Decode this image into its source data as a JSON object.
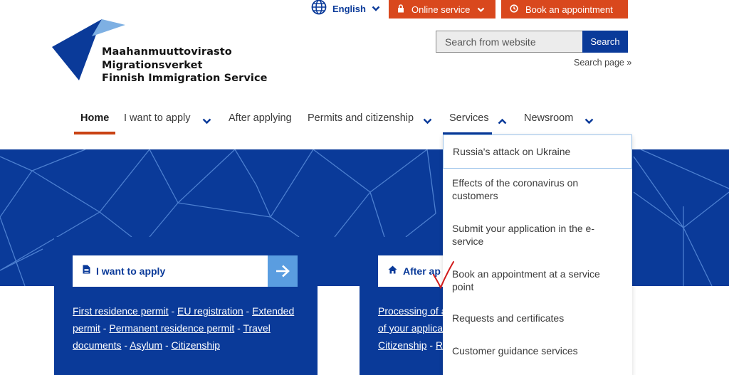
{
  "header": {
    "language": {
      "label": "English",
      "icon": "globe-icon"
    },
    "online_service": {
      "label": "Online service",
      "icon": "lock-icon"
    },
    "book_appointment": {
      "label": "Book an appointment",
      "icon": "clock-icon"
    }
  },
  "logo": {
    "line1": "Maahanmuuttovirasto",
    "line2": "Migrationsverket",
    "line3": "Finnish Immigration Service"
  },
  "search": {
    "placeholder": "Search from website",
    "button_label": "Search",
    "page_link": "Search page »"
  },
  "nav": {
    "items": [
      {
        "label": "Home",
        "active": true
      },
      {
        "label": "I want to apply",
        "has_dropdown": true
      },
      {
        "label": "After applying"
      },
      {
        "label": "Permits and citizenship",
        "has_dropdown": true
      },
      {
        "label": "Services",
        "has_dropdown": true,
        "expanded": true
      },
      {
        "label": "Newsroom",
        "has_dropdown": true
      }
    ]
  },
  "dropdown": {
    "items": [
      "Russia's attack on Ukraine",
      "Effects of the coronavirus on customers",
      "Submit your application in the e-service",
      "Book an appointment at a service point",
      "Requests and certificates",
      "Customer guidance services"
    ]
  },
  "cards": {
    "apply": {
      "title": "I want to apply",
      "icon": "document-icon",
      "links": [
        "First residence permit",
        "EU registration",
        "Extended permit",
        "Permanent residence permit",
        "Travel documents",
        "Asylum",
        "Citizenship"
      ],
      "separator": "-"
    },
    "after": {
      "title": "After applying",
      "title_visible": "After ap",
      "icon": "home-icon",
      "lines": [
        "Processing of a",
        "of your applica",
        "Citizenship",
        "Re"
      ]
    }
  },
  "colors": {
    "brand_blue": "#0a3a99",
    "accent_orange": "#d9481d",
    "light_blue": "#5a9de0",
    "active_underline": "#c94213",
    "annotation_red": "#d11a1a"
  }
}
